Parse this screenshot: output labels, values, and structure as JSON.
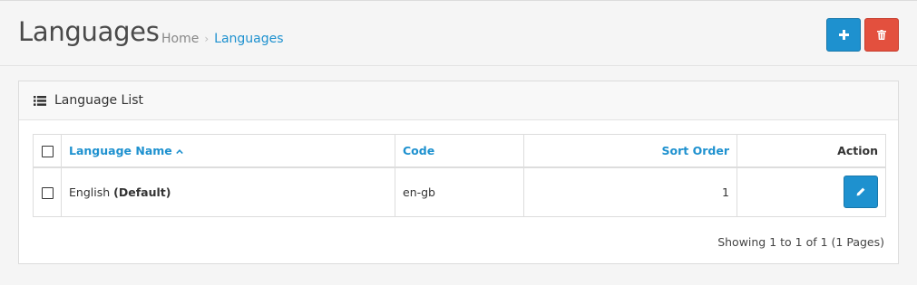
{
  "header": {
    "title": "Languages",
    "breadcrumb": [
      {
        "label": "Home"
      },
      {
        "label": "Languages"
      }
    ],
    "add_button_icon": "plus-icon",
    "delete_button_icon": "trash-icon",
    "colors": {
      "primary": "#1e91cf",
      "danger": "#e3503e"
    }
  },
  "panel": {
    "title_icon": "list-icon",
    "title": "Language List"
  },
  "table": {
    "columns": {
      "name": "Language Name",
      "code": "Code",
      "sort_order": "Sort Order",
      "action": "Action"
    },
    "sorted_by": "name",
    "sort_direction": "asc",
    "rows": [
      {
        "name": "English",
        "default_label": "(Default)",
        "code": "en-gb",
        "sort_order": "1",
        "selected": false
      }
    ]
  },
  "pagination": {
    "text": "Showing 1 to 1 of 1 (1 Pages)"
  }
}
